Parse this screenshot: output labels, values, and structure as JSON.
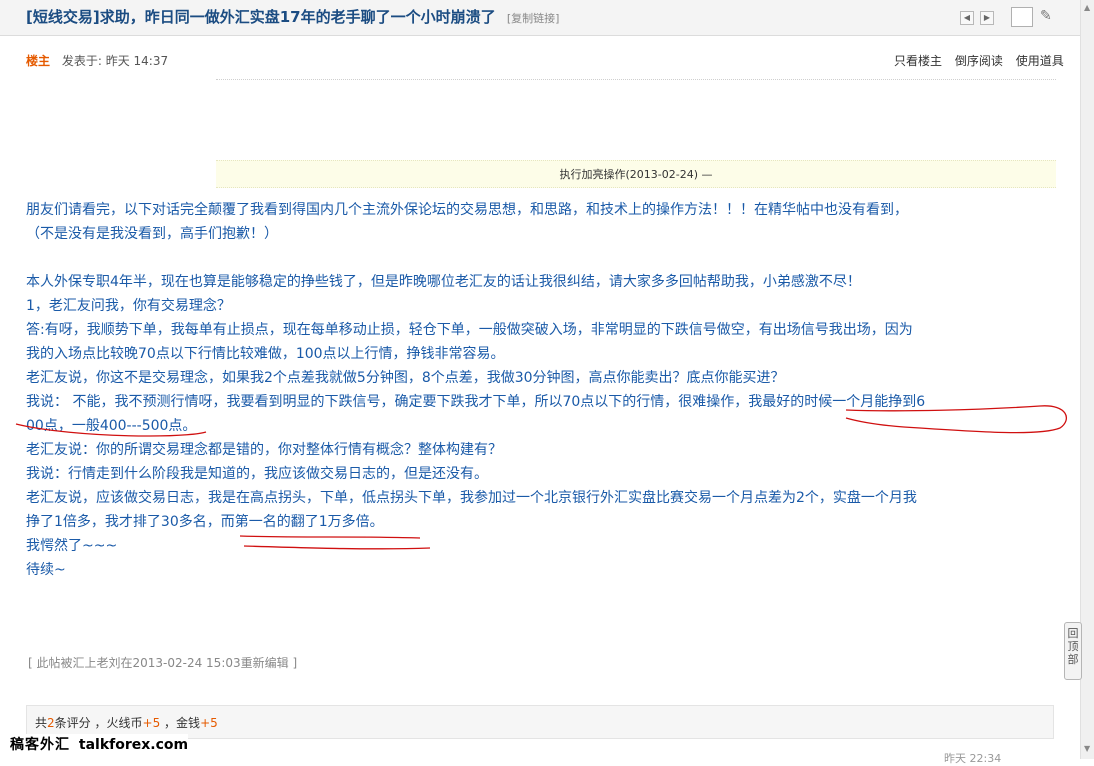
{
  "thread": {
    "title": "[短线交易]求助，昨日同一做外汇实盘17年的老手聊了一个小时崩溃了",
    "copy_link": "[复制链接]"
  },
  "post": {
    "author_tag": "楼主",
    "posted_at": "发表于: 昨天 14:37",
    "tools": [
      "只看楼主",
      "倒序阅读",
      "使用道具"
    ],
    "op_notice": "执行加亮操作(2013-02-24) —",
    "paragraphs": [
      "朋友们请看完，以下对话完全颠覆了我看到得国内几个主流外保论坛的交易思想，和思路，和技术上的操作方法！！！在精华帖中也没有看到，",
      "（不是没有是我没看到，高手们抱歉！）",
      "",
      "本人外保专职4年半，现在也算是能够稳定的挣些钱了，但是昨晚哪位老汇友的话让我很纠结，请大家多多回帖帮助我，小弟感激不尽！",
      "1，老汇友问我，你有交易理念？",
      "答:有呀，我顺势下单，我每单有止损点，现在每单移动止损，轻仓下单，一般做突破入场，非常明显的下跌信号做空，有出场信号我出场，因为",
      "我的入场点比较晚70点以下行情比较难做，100点以上行情，挣钱非常容易。",
      "老汇友说，你这不是交易理念，如果我2个点差我就做5分钟图，8个点差，我做30分钟图，高点你能卖出？底点你能买进？",
      "我说：  不能，我不预测行情呀，我要看到明显的下跌信号，确定要下跌我才下单，所以70点以下的行情，很难操作，我最好的时候一个月能挣到6",
      "00点，一般400---500点。",
      "老汇友说：你的所谓交易理念都是错的，你对整体行情有概念？整体构建有？",
      "我说：行情走到什么阶段我是知道的，我应该做交易日志的，但是还没有。",
      "老汇友说，应该做交易日志，我是在高点拐头，下单，低点拐头下单，我参加过一个北京银行外汇实盘比赛交易一个月点差为2个，实盘一个月我",
      "挣了1倍多，我才排了30多名，而第一名的翻了1万多倍。",
      "我愕然了~~~",
      "待续~"
    ],
    "edit_note": "[ 此帖被汇上老刘在2013-02-24 15:03重新编辑 ]"
  },
  "rating": {
    "prefix": "共",
    "count": "2",
    "count_suffix": "条评分",
    "huoxianbi_label": "，火线币",
    "huoxianbi_value": "+5",
    "jinqian_label": "，金钱",
    "jinqian_value": "+5"
  },
  "watermark": {
    "cn_text": "稿客外汇",
    "en_text": "talkforex.com"
  },
  "bottom_time": "昨天 22:34",
  "back_to_top": [
    "回",
    "顶",
    "部"
  ],
  "icons": {
    "prev": "triangle-left",
    "next": "triangle-right",
    "tool": "wrench"
  },
  "colors": {
    "title": "#1b4c82",
    "body_text": "#1a5aa8",
    "accent_orange": "#e55a00",
    "annotation_red": "#d01010"
  }
}
